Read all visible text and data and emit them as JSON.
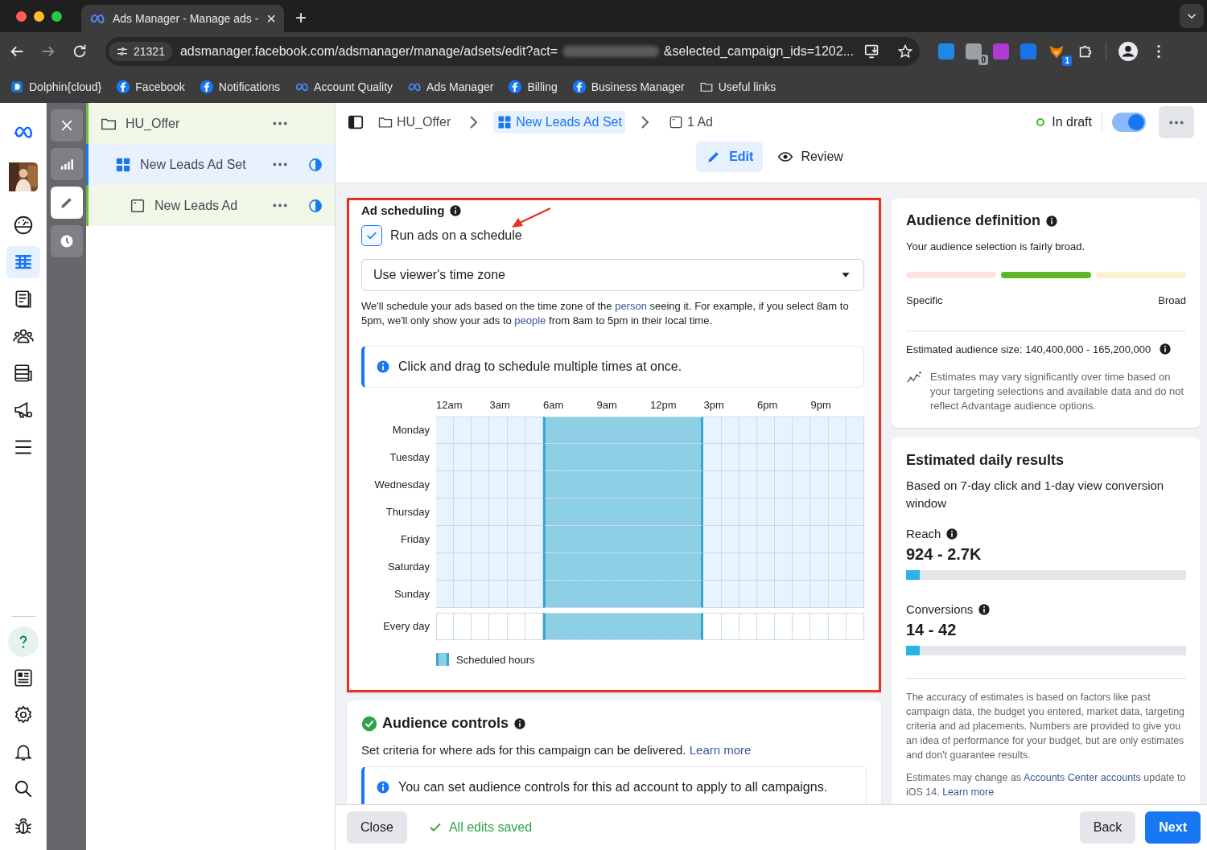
{
  "browser": {
    "tab": {
      "title": "Ads Manager - Manage ads -",
      "close": "×"
    },
    "new_tab": "+",
    "site_badge": "21321",
    "url_start": "adsmanager.facebook.com/adsmanager/manage/adsets/edit?act=",
    "url_redacted": true,
    "url_end": "&selected_campaign_ids=1202...",
    "extensions": [
      {
        "kind": "hf"
      },
      {
        "kind": "files",
        "badge": "0"
      },
      {
        "kind": "dpurple"
      },
      {
        "kind": "dblue"
      },
      {
        "kind": "fox",
        "badge": "1"
      },
      {
        "kind": "puzzle"
      }
    ],
    "bookmarks": [
      {
        "label": "Dolphin{cloud}",
        "kind": "dolphin"
      },
      {
        "label": "Facebook",
        "kind": "facebook"
      },
      {
        "label": "Notifications",
        "kind": "facebook"
      },
      {
        "label": "Account Quality",
        "kind": "meta"
      },
      {
        "label": "Ads Manager",
        "kind": "meta"
      },
      {
        "label": "Billing",
        "kind": "facebook"
      },
      {
        "label": "Business Manager",
        "kind": "facebook"
      },
      {
        "label": "Useful links",
        "kind": "folder"
      }
    ]
  },
  "nav": {
    "top": [
      {
        "kind": "meta",
        "selected": false
      },
      {
        "kind": "avatar",
        "selected": false
      },
      {
        "kind": "gauge",
        "selected": false
      },
      {
        "kind": "table",
        "selected": true
      },
      {
        "kind": "pages",
        "selected": false
      },
      {
        "kind": "people",
        "selected": false
      },
      {
        "kind": "stack",
        "selected": false
      },
      {
        "kind": "megaphone",
        "selected": false
      },
      {
        "kind": "menu",
        "selected": false
      }
    ],
    "bottom": [
      {
        "kind": "help",
        "selected": true
      },
      {
        "kind": "news",
        "selected": false
      },
      {
        "kind": "gear",
        "selected": false
      },
      {
        "kind": "bell",
        "selected": false
      },
      {
        "kind": "search",
        "selected": false
      },
      {
        "kind": "bug",
        "selected": false
      }
    ]
  },
  "tools": [
    {
      "kind": "close",
      "selected": false
    },
    {
      "kind": "chart",
      "selected": false
    },
    {
      "kind": "pencil",
      "selected": true
    },
    {
      "kind": "clock",
      "selected": false
    }
  ],
  "tree": [
    {
      "label": "HU_Offer",
      "kind": "folder",
      "selected": false,
      "children": [
        {
          "label": "New Leads Ad Set",
          "kind": "adset",
          "selected": true,
          "children": [
            {
              "label": "New Leads Ad",
              "kind": "ad",
              "selected": false
            }
          ]
        }
      ]
    }
  ],
  "header": {
    "breadcrumb": [
      {
        "label": "HU_Offer",
        "kind": "folder",
        "selected": false
      },
      {
        "label": "New Leads Ad Set",
        "kind": "adset",
        "selected": true
      },
      {
        "label": "1 Ad",
        "kind": "ad",
        "selected": false
      }
    ],
    "status": "In draft",
    "toggle_on": true,
    "modes": [
      {
        "label": "Edit",
        "kind": "pencil",
        "selected": true
      },
      {
        "label": "Review",
        "kind": "eye",
        "selected": false
      }
    ]
  },
  "ad_scheduling": {
    "highlighted": true,
    "title": "Ad scheduling",
    "checkbox": {
      "label": "Run ads on a schedule",
      "checked": true
    },
    "dropdown": {
      "value": "Use viewer's time zone"
    },
    "description": [
      {
        "text": "We'll schedule your ads based on the time zone of the "
      },
      {
        "text": "person",
        "link": true
      },
      {
        "text": " seeing it. For example, if you select 8am to 5pm, we'll only show your ads to "
      },
      {
        "text": "people",
        "link": true
      },
      {
        "text": " from 8am to 5pm in their local time."
      }
    ],
    "notice": "Click and drag to schedule multiple times at once.",
    "hour_labels": [
      "12am",
      "3am",
      "6am",
      "9am",
      "12pm",
      "3pm",
      "6pm",
      "9pm"
    ],
    "rows": [
      {
        "label": "Monday",
        "kind": "day",
        "hours": [
          false,
          false,
          false,
          false,
          false,
          false,
          true,
          true,
          true,
          true,
          true,
          true,
          true,
          true,
          true,
          false,
          false,
          false,
          false,
          false,
          false,
          false,
          false,
          false
        ]
      },
      {
        "label": "Tuesday",
        "kind": "day",
        "hours": [
          false,
          false,
          false,
          false,
          false,
          false,
          true,
          true,
          true,
          true,
          true,
          true,
          true,
          true,
          true,
          false,
          false,
          false,
          false,
          false,
          false,
          false,
          false,
          false
        ]
      },
      {
        "label": "Wednesday",
        "kind": "day",
        "hours": [
          false,
          false,
          false,
          false,
          false,
          false,
          true,
          true,
          true,
          true,
          true,
          true,
          true,
          true,
          true,
          false,
          false,
          false,
          false,
          false,
          false,
          false,
          false,
          false
        ]
      },
      {
        "label": "Thursday",
        "kind": "day",
        "hours": [
          false,
          false,
          false,
          false,
          false,
          false,
          true,
          true,
          true,
          true,
          true,
          true,
          true,
          true,
          true,
          false,
          false,
          false,
          false,
          false,
          false,
          false,
          false,
          false
        ]
      },
      {
        "label": "Friday",
        "kind": "day",
        "hours": [
          false,
          false,
          false,
          false,
          false,
          false,
          true,
          true,
          true,
          true,
          true,
          true,
          true,
          true,
          true,
          false,
          false,
          false,
          false,
          false,
          false,
          false,
          false,
          false
        ]
      },
      {
        "label": "Saturday",
        "kind": "day",
        "hours": [
          false,
          false,
          false,
          false,
          false,
          false,
          true,
          true,
          true,
          true,
          true,
          true,
          true,
          true,
          true,
          false,
          false,
          false,
          false,
          false,
          false,
          false,
          false,
          false
        ]
      },
      {
        "label": "Sunday",
        "kind": "day",
        "hours": [
          false,
          false,
          false,
          false,
          false,
          false,
          true,
          true,
          true,
          true,
          true,
          true,
          true,
          true,
          true,
          false,
          false,
          false,
          false,
          false,
          false,
          false,
          false,
          false
        ]
      },
      {
        "label": "Every day",
        "kind": "summary",
        "hours": [
          false,
          false,
          false,
          false,
          false,
          false,
          true,
          true,
          true,
          true,
          true,
          true,
          true,
          true,
          true,
          false,
          false,
          false,
          false,
          false,
          false,
          false,
          false,
          false
        ]
      }
    ],
    "legend": "Scheduled hours"
  },
  "audience_controls": {
    "title": "Audience controls",
    "done": true,
    "text": [
      {
        "text": "Set criteria for where ads for this campaign can be delivered. "
      },
      {
        "text": "Learn more",
        "link": true
      }
    ],
    "notice": "You can set audience controls for this ad account to apply to all campaigns."
  },
  "audience_definition": {
    "title": "Audience definition",
    "text": "Your audience selection is fairly broad.",
    "segments": [
      {
        "color": "#fbe3e1"
      },
      {
        "color": "#5cb824"
      },
      {
        "color": "#fdf1d0"
      }
    ],
    "min_label": "Specific",
    "max_label": "Broad",
    "size": "Estimated audience size: 140,400,000 - 165,200,000",
    "note": "Estimates may vary significantly over time based on your targeting selections and available data and do not reflect Advantage audience options."
  },
  "daily_results": {
    "title": "Estimated daily results",
    "subtitle": "Based on 7-day click and 1-day view conversion window",
    "metrics": [
      {
        "label": "Reach",
        "value": "924 - 2.7K",
        "level": 0.05
      },
      {
        "label": "Conversions",
        "value": "14 - 42",
        "level": 0.05
      }
    ],
    "disclaimer": "The accuracy of estimates is based on factors like past campaign data, the budget you entered, market data, targeting criteria and ad placements. Numbers are provided to give you an idea of performance for your budget, but are only estimates and don't guarantee results.",
    "ios_note": [
      {
        "text": "Estimates may change as "
      },
      {
        "text": "Accounts Center accounts",
        "link": true
      },
      {
        "text": " update to iOS 14. "
      },
      {
        "text": "Learn more",
        "link": true
      }
    ]
  },
  "footer": {
    "close": "Close",
    "saved": "All edits saved",
    "back": "Back",
    "next": "Next"
  }
}
